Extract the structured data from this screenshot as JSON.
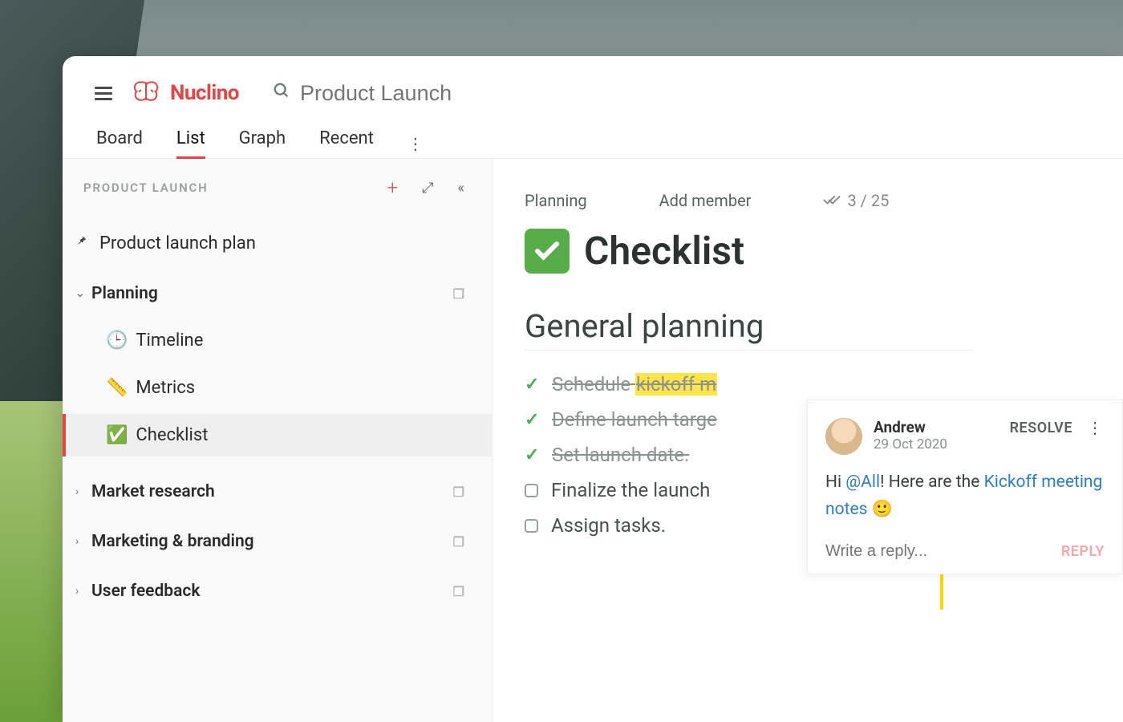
{
  "brand": {
    "name": "Nuclino"
  },
  "search": {
    "placeholder": "Product Launch"
  },
  "viewtabs": {
    "t0": "Board",
    "t1": "List",
    "t2": "Graph",
    "t3": "Recent"
  },
  "sidebar": {
    "title": "PRODUCT LAUNCH",
    "pinned": "Product launch plan",
    "groups": {
      "planning": {
        "label": "Planning",
        "children": {
          "c0": "Timeline",
          "c1": "Metrics",
          "c2": "Checklist"
        }
      },
      "market": {
        "label": "Market research"
      },
      "marketing": {
        "label": "Marketing & branding"
      },
      "feedback": {
        "label": "User feedback"
      }
    }
  },
  "doc": {
    "breadcrumb": "Planning",
    "addmember": "Add member",
    "readcount": "3 / 25",
    "title": "Checklist",
    "section": "General planning",
    "items": {
      "i0a": "Schedule ",
      "i0b": "kickoff m",
      "i1": "Define launch targe",
      "i2": "Set launch date.",
      "i3": "Finalize the launch",
      "i4": "Assign tasks."
    }
  },
  "comment": {
    "author": "Andrew",
    "date": "29 Oct 2020",
    "resolve": "RESOLVE",
    "body": {
      "pre": "Hi ",
      "mention": "@All",
      "mid": "! Here are the ",
      "link": "Kickoff meeting notes",
      "emoji": " 🙂"
    },
    "reply_placeholder": "Write a reply...",
    "reply_btn": "REPLY"
  }
}
